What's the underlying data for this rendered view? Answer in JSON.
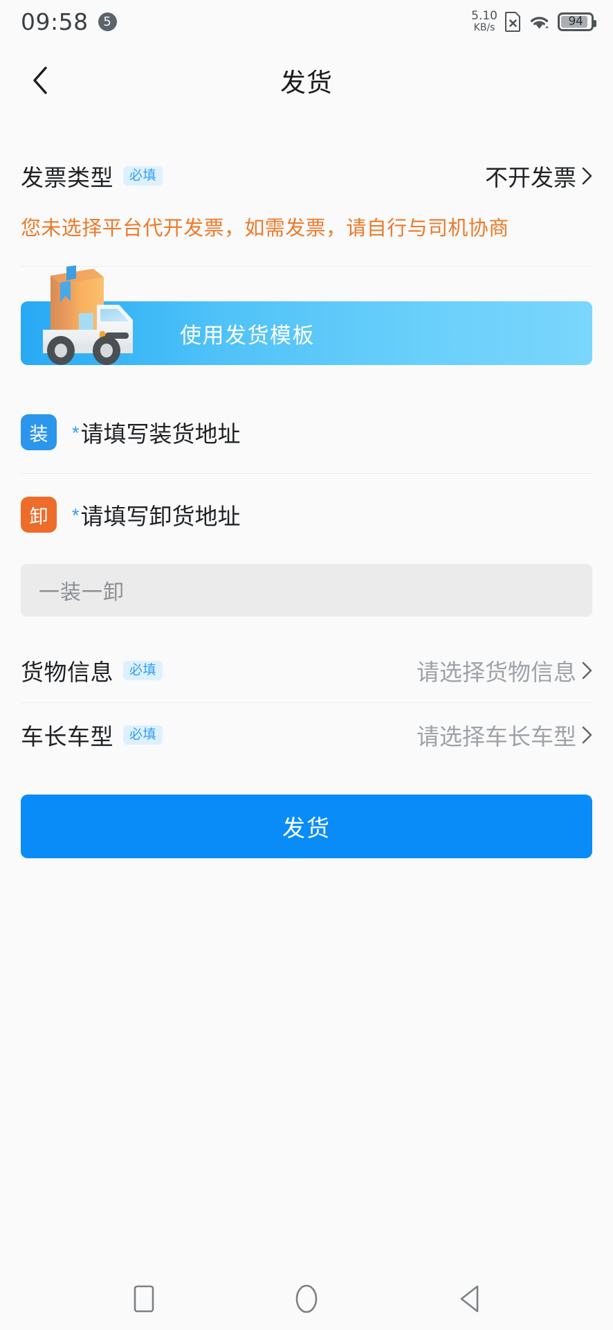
{
  "status_bar": {
    "time": "09:58",
    "notif_count": "5",
    "net_speed_value": "5.10",
    "net_speed_unit": "KB/s",
    "sim_icon": "sim-card-disabled-icon",
    "wifi_icon": "wifi-icon",
    "battery_level": "94"
  },
  "header": {
    "back_icon": "chevron-left-icon",
    "title": "发货"
  },
  "invoice": {
    "label": "发票类型",
    "required_badge": "必填",
    "value": "不开发票",
    "chevron_icon": "chevron-right-icon",
    "hint": "您未选择平台代开发票，如需发票，请自行与司机协商",
    "hint_color": "#ec7a2a"
  },
  "template_banner": {
    "label": "使用发货模板",
    "illustration": "delivery-truck-illustration",
    "gradient_from": "#28a9f3",
    "gradient_to": "#7ad6fc"
  },
  "addresses": [
    {
      "badge": "装",
      "badge_color": "#2b96ec",
      "required_mark": "*",
      "text": "请填写装货地址",
      "name": "loading-address-row"
    },
    {
      "badge": "卸",
      "badge_color": "#ee6c2a",
      "required_mark": "*",
      "text": "请填写卸货地址",
      "name": "unloading-address-row"
    }
  ],
  "route_summary": "一装一卸",
  "fields": [
    {
      "label": "货物信息",
      "required_badge": "必填",
      "value": "请选择货物信息",
      "chevron_icon": "chevron-right-icon",
      "name": "cargo-info-row"
    },
    {
      "label": "车长车型",
      "required_badge": "必填",
      "value": "请选择车长车型",
      "chevron_icon": "chevron-right-icon",
      "name": "vehicle-type-row"
    }
  ],
  "submit": {
    "label": "发货",
    "color": "#0a8cf8"
  },
  "nav_bar": {
    "recents_icon": "square-recents-icon",
    "home_icon": "circle-home-icon",
    "back_icon": "triangle-back-icon"
  }
}
